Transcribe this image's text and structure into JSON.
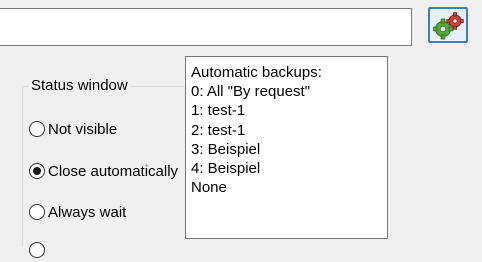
{
  "path_input": {
    "value": ""
  },
  "settings_button": {
    "icon": "gears-icon"
  },
  "status_window": {
    "legend": "Status window",
    "options": [
      {
        "label": "Not visible",
        "checked": false
      },
      {
        "label": "Close automatically",
        "checked": true
      },
      {
        "label": "Always wait",
        "checked": false
      }
    ]
  },
  "tooltip": {
    "lines": [
      "Automatic backups:",
      "0: All \"By request\"",
      "1: test-1",
      "2: test-1",
      "3: Beispiel",
      "4: Beispiel",
      "None"
    ]
  }
}
